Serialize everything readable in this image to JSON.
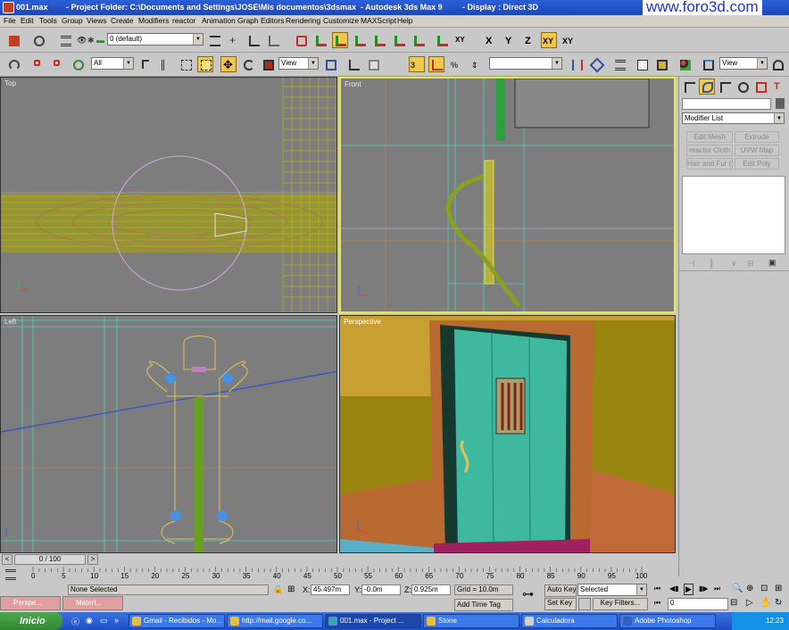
{
  "titlebar": {
    "file": "001.max",
    "project": "- Project Folder: C:\\Documents and Settings\\JOSE\\Mis documentos\\3dsmax",
    "app": "- Autodesk 3ds Max 9",
    "display": "- Display : Direct 3D",
    "watermark": "www.foro3d.com"
  },
  "menu": [
    "File",
    "Edit",
    "Tools",
    "Group",
    "Views",
    "Create",
    "Modifiers",
    "reactor",
    "Animation",
    "Graph Editors",
    "Rendering",
    "Customize",
    "MAXScript",
    "Help"
  ],
  "toolbar1": {
    "layer_value": "0 (default)",
    "xyz": [
      "X",
      "Y",
      "Z",
      "XY",
      "XY"
    ]
  },
  "toolbar2": {
    "filter_value": "All",
    "refcoord_value": "View",
    "selection_set_value": "",
    "render_view_value": "View"
  },
  "viewports": {
    "top": "Top",
    "front": "Front",
    "left": "Left",
    "perspective": "Perspective"
  },
  "command_panel": {
    "name_value": "",
    "modifier_list": "Modifier List",
    "buttons": [
      "Edit Mesh",
      "Extrude",
      "reactor Cloth",
      "UVW Map",
      "Hair and Fur (WS",
      "Edit Poly"
    ]
  },
  "timeslider": {
    "label": "0 / 100"
  },
  "track_ticks": [
    "0",
    "5",
    "10",
    "15",
    "20",
    "25",
    "30",
    "35",
    "40",
    "45",
    "50",
    "55",
    "60",
    "65",
    "70",
    "75",
    "80",
    "85",
    "90",
    "95",
    "100"
  ],
  "status": {
    "none_selected": "None Selected",
    "x_label": "X:",
    "x_value": "45.497m",
    "y_label": "Y:",
    "y_value": "-0.0m",
    "z_label": "Z:",
    "z_value": "0.925m",
    "grid": "Grid = 10.0m",
    "add_time_tag": "Add Time Tag",
    "auto_key": "Auto Key",
    "set_key": "Set Key",
    "selected": "Selected",
    "key_filters": "Key Filters...",
    "frame_value": "0"
  },
  "minimized": [
    "Perspe...",
    "Materi..."
  ],
  "taskbar": {
    "start": "Inicio",
    "tasks": [
      "Gmail - Recibidos - Mo...",
      "http://mail.google.co...",
      "001.max - Project ...",
      "Stone",
      "Calculadora",
      "Adobe Photoshop"
    ],
    "clock": "12:23"
  }
}
